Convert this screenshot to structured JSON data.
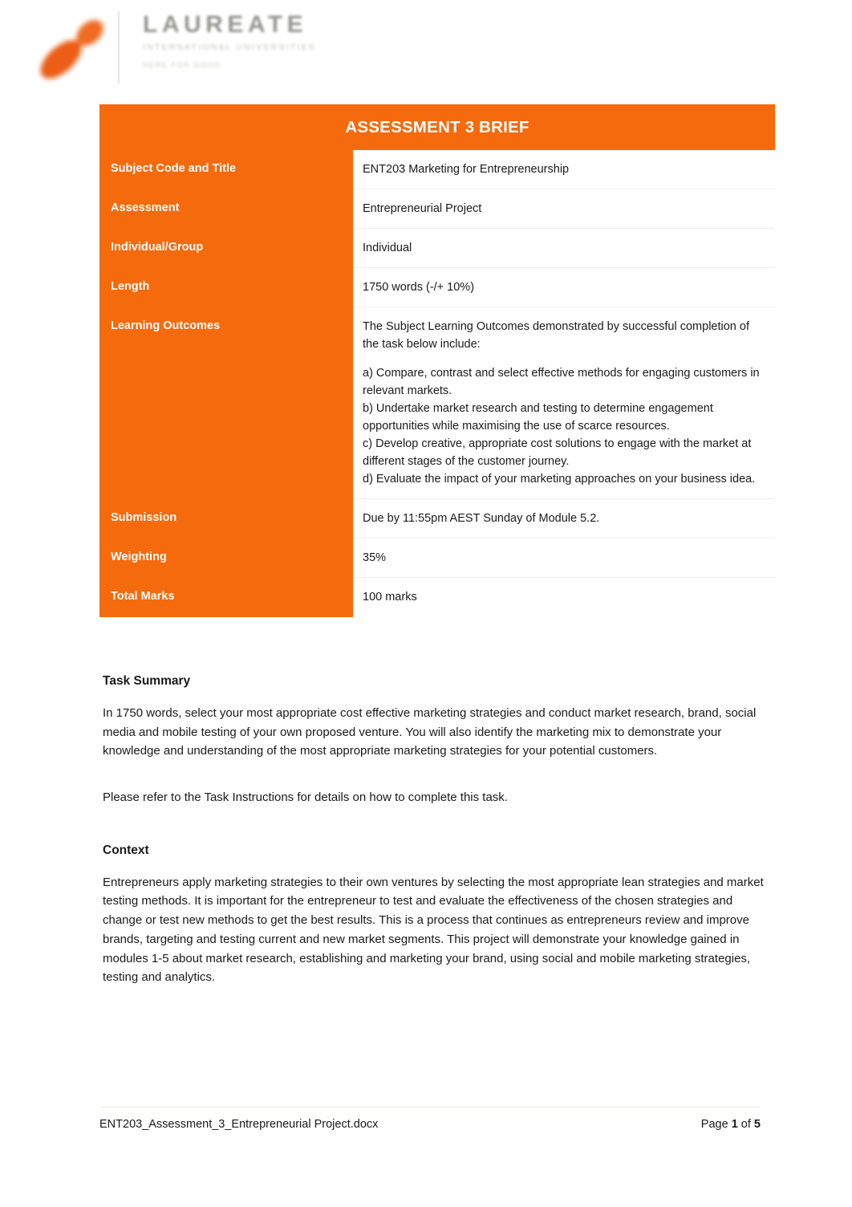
{
  "letterhead": {
    "logo_mark_name": "laureate-leaf-logo-icon",
    "logo_word": "LAUREATE",
    "logo_sub1": "INTERNATIONAL UNIVERSITIES",
    "logo_sub2": "HERE FOR GOOD"
  },
  "brief": {
    "header_title": "ASSESSMENT 3 BRIEF",
    "rows": [
      {
        "label": "Subject Code and Title",
        "value": "ENT203 Marketing for Entrepreneurship"
      },
      {
        "label": "Assessment",
        "value": "Entrepreneurial Project"
      },
      {
        "label": "Individual/Group",
        "value": "Individual"
      },
      {
        "label": "Length",
        "value": "1750 words (-/+ 10%)"
      },
      {
        "label": "Learning Outcomes",
        "value_intro": "The Subject Learning Outcomes demonstrated by successful completion of the task below include:",
        "outcomes": [
          "a) Compare, contrast and select effective methods for engaging customers in relevant markets.",
          "b) Undertake market research and testing to determine engagement opportunities while maximising the use of scarce resources.",
          "c) Develop creative, appropriate cost solutions to engage with the market at different stages of the customer journey.",
          "d) Evaluate the impact of your marketing approaches on your business idea."
        ]
      },
      {
        "label": "Submission",
        "value": "Due by 11:55pm AEST Sunday of Module 5.2."
      },
      {
        "label": "Weighting",
        "value": "35%"
      },
      {
        "label": "Total Marks",
        "value": "100 marks"
      }
    ]
  },
  "sections": [
    {
      "heading": "Task Summary",
      "paragraphs": [
        "In 1750 words, select your most appropriate cost effective marketing strategies and conduct market research, brand, social media and mobile testing of your own proposed venture. You will also identify the marketing mix to demonstrate your knowledge and understanding of the most appropriate marketing strategies for your potential customers.",
        "Please refer to the Task Instructions for details on how to complete this task."
      ]
    },
    {
      "heading": "Context",
      "paragraphs": [
        "Entrepreneurs apply marketing strategies to their own ventures by selecting the most appropriate lean strategies and market testing methods.  It is important for the entrepreneur to test and evaluate the effectiveness of the chosen strategies and change or test new methods to get the best results. This is a process that continues as entrepreneurs review and improve brands, targeting and testing current and new market segments. This project will demonstrate your knowledge gained in modules 1-5 about market research, establishing and marketing your brand, using social and mobile marketing strategies, testing and analytics."
      ]
    }
  ],
  "footer": {
    "file_name": "ENT203_Assessment_3_Entrepreneurial Project.docx",
    "page_prefix": "Page ",
    "page_current": "1",
    "page_mid": " of ",
    "page_total": "5"
  },
  "colors": {
    "brand_orange": "#f56a0c",
    "text": "#1a1a1a",
    "row_divider": "#efefef"
  }
}
